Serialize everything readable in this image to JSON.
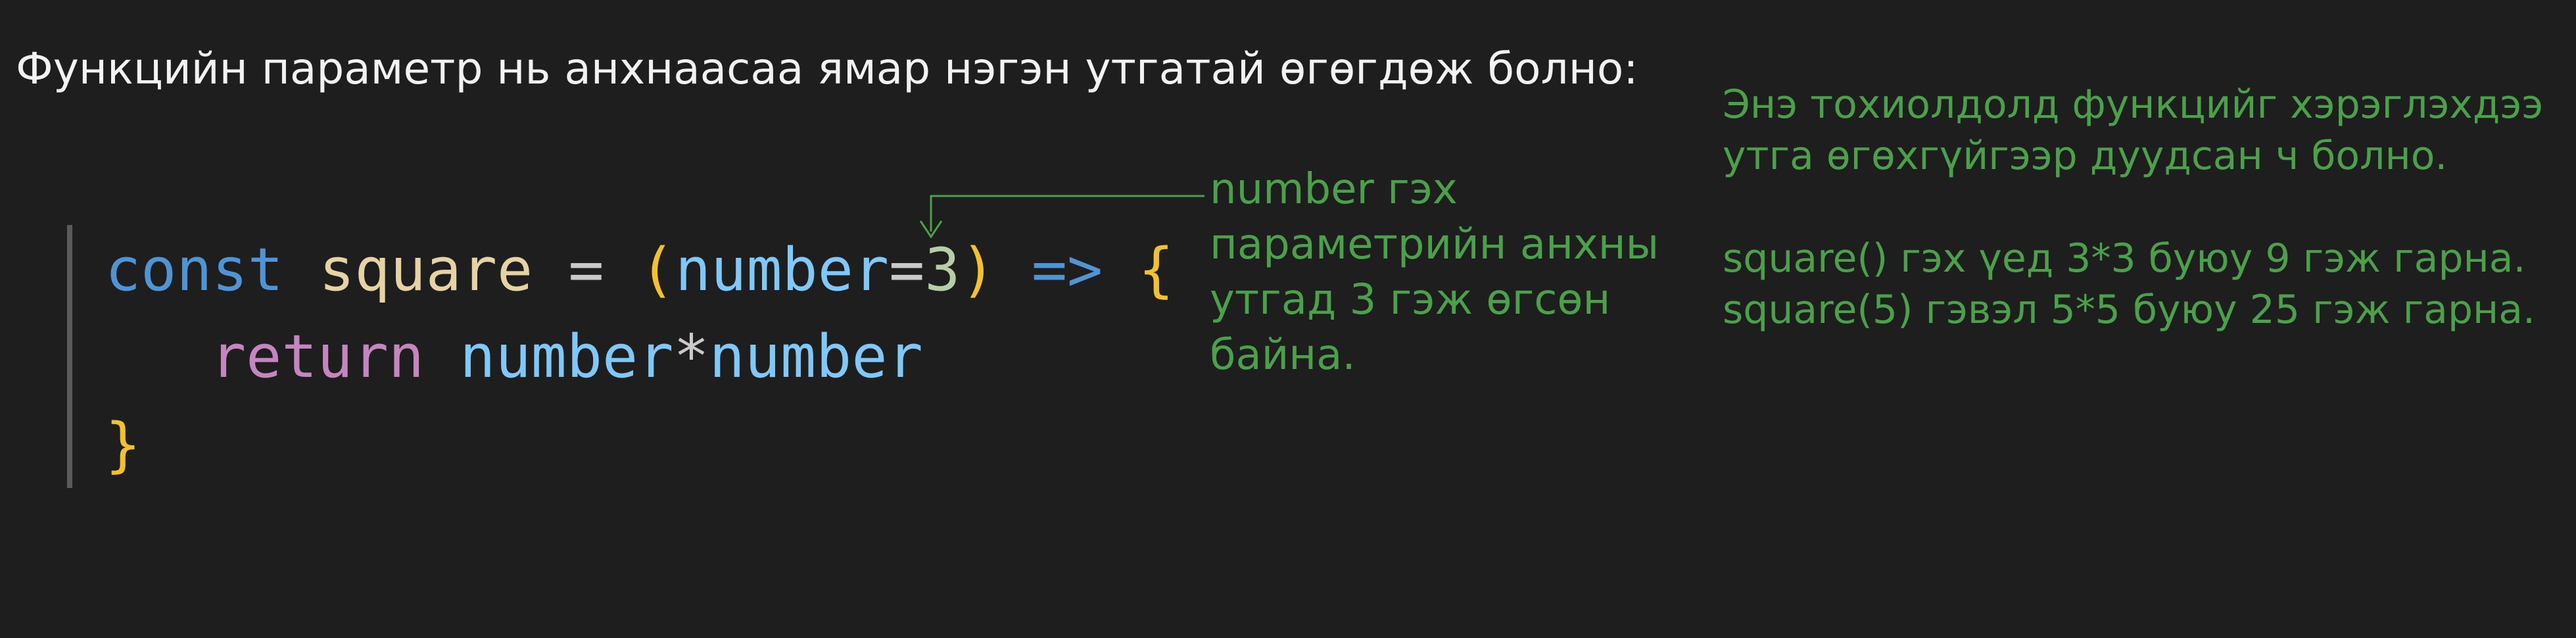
{
  "heading": "Функцийн параметр нь анхнаасаа ямар нэгэн утгатай өгөгдөж болно:",
  "code": {
    "line1": {
      "kw_const": "const",
      "ident": "square",
      "eq": "=",
      "paren_open": "(",
      "param": "number",
      "param_eq": "=",
      "default_value": "3",
      "paren_close": ")",
      "arrow": "=>",
      "brace_open": "{"
    },
    "line2": {
      "kw_return": "return",
      "expr_left": "number",
      "expr_op": "*",
      "expr_right": "number"
    },
    "line3": {
      "brace_close": "}"
    }
  },
  "annotation_left": {
    "lines": [
      "number гэх",
      "параметрийн анхны",
      "утгад 3 гэж өгсөн",
      "байна."
    ]
  },
  "annotation_right": {
    "para1": [
      "Энэ тохиолдолд функцийг хэрэглэхдээ",
      "утга өгөхгүйгээр дуудсан ч болно."
    ],
    "para2": [
      "square() гэх үед 3*3 буюу 9 гэж гарна.",
      "square(5) гэвэл 5*5 буюу 25 гэж гарна."
    ]
  },
  "colors": {
    "background": "#1e1e1e",
    "annotation_green": "#4aa14a",
    "keyword_blue": "#4f94d4",
    "keyword_purple": "#c586c0",
    "bracket_yellow": "#f2c12e"
  }
}
